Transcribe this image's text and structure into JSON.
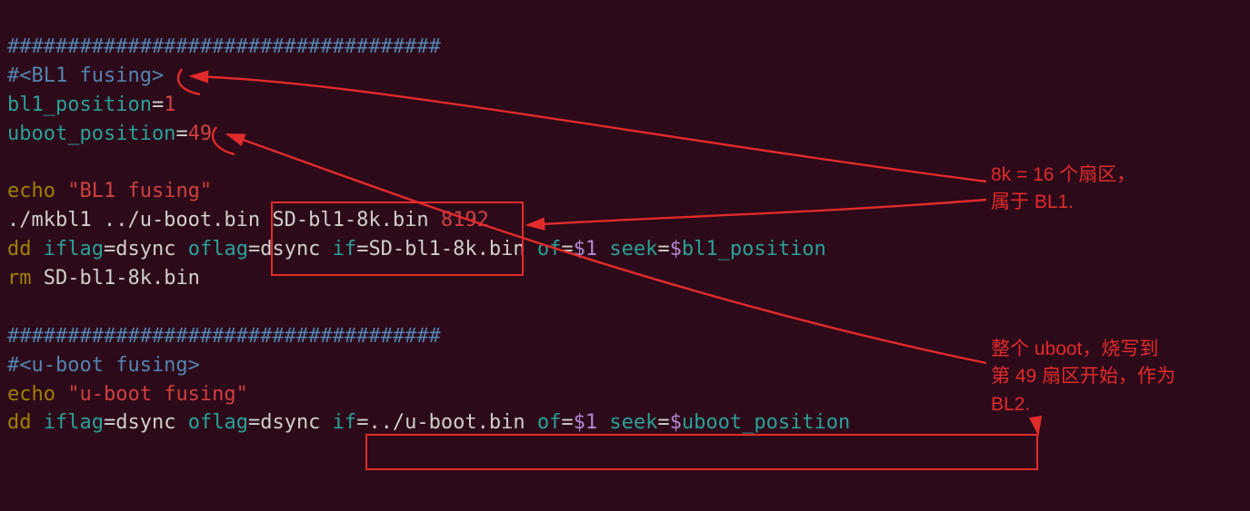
{
  "code": {
    "hash1": "####################################",
    "comment_bl1": "#<BL1 fusing>",
    "var_bl1": "bl1_position",
    "val_bl1": "1",
    "var_uboot": "uboot_position",
    "val_uboot": "49",
    "echo": "echo",
    "echo_bl1_str": "\"BL1 fusing\"",
    "mkbl1": "./mkbl1 ../u-boot.bin",
    "sdfile": " SD-bl1-8k.bin ",
    "size8192": "8192",
    "dd": "dd",
    "iflag": " iflag",
    "dsync": "dsync",
    "oflag": " oflag",
    "if": " if",
    "sdbl1": "SD-bl1-8k.bin",
    "of": " of",
    "dollar1": "$1",
    "seek": " seek",
    "dollar": "$",
    "bl1pos": "bl1_position",
    "rm": "rm",
    "rm_file": " SD-bl1-8k.bin",
    "hash2": "####################################",
    "comment_uboot": "#<u-boot fusing>",
    "echo_uboot_str": "\"u-boot fusing\"",
    "ubootbin": "../u-boot.bin",
    "ubootpos": "uboot_position",
    "eq": "="
  },
  "annot": {
    "note1_l1": "8k = 16 个扇区，",
    "note1_l2": "属于 BL1.",
    "note2_l1": "整个 uboot，烧写到",
    "note2_l2": "第 49 扇区开始，作为",
    "note2_l3": "BL2."
  }
}
